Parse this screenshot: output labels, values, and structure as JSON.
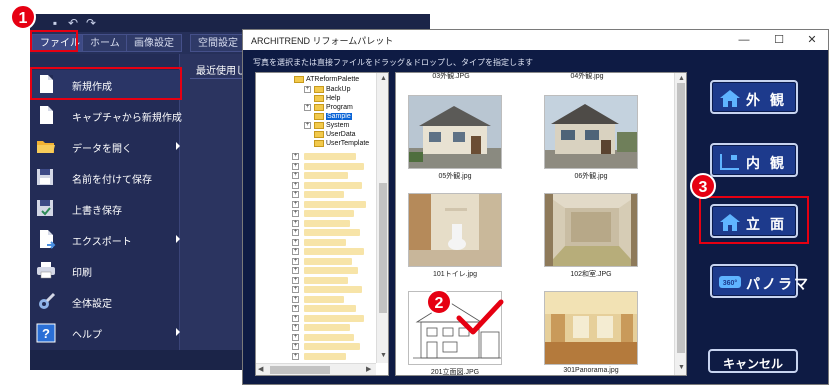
{
  "app": {
    "ribbon_tabs": [
      "ファイル",
      "ホーム",
      "画像設定",
      "空間設定"
    ],
    "file_menu": {
      "items": [
        {
          "label": "新規作成",
          "icon": "new-document-icon",
          "has_submenu": false
        },
        {
          "label": "キャプチャから新規作成",
          "icon": "capture-document-icon",
          "has_submenu": false
        },
        {
          "label": "データを開く",
          "icon": "open-folder-icon",
          "has_submenu": true
        },
        {
          "label": "名前を付けて保存",
          "icon": "save-as-icon",
          "has_submenu": false
        },
        {
          "label": "上書き保存",
          "icon": "save-icon",
          "has_submenu": false
        },
        {
          "label": "エクスポート",
          "icon": "export-icon",
          "has_submenu": true
        },
        {
          "label": "印刷",
          "icon": "print-icon",
          "has_submenu": false
        },
        {
          "label": "全体設定",
          "icon": "settings-icon",
          "has_submenu": false
        },
        {
          "label": "ヘルプ",
          "icon": "help-icon",
          "has_submenu": true
        }
      ],
      "recent_label": "最近使用し"
    }
  },
  "dialog": {
    "title": "ARCHITREND リフォームパレット",
    "window_controls": {
      "minimize": "—",
      "maximize": "☐",
      "close": "✕"
    },
    "instruction": "写真を選択または直接ファイルをドラッグ＆ドロップし、タイプを指定します",
    "tree": {
      "root": "ATReformPalette",
      "children": [
        "BackUp",
        "Help",
        "Program",
        "Sample",
        "System",
        "UserData",
        "UserTemplate"
      ],
      "selected": "Sample"
    },
    "images": {
      "top_captions": [
        "03外観.JPG",
        "04外観.jpg"
      ],
      "items": [
        {
          "caption": "05外観.jpg"
        },
        {
          "caption": "06外観.jpg"
        },
        {
          "caption": "101トイレ.jpg"
        },
        {
          "caption": "102和室.JPG"
        },
        {
          "caption": "201立面図.JPG"
        },
        {
          "caption": "301Panorama.jpg"
        }
      ]
    },
    "view_buttons": [
      {
        "label": "外観",
        "icon": "exterior-house-icon"
      },
      {
        "label": "内観",
        "icon": "interior-room-icon"
      },
      {
        "label": "立面",
        "icon": "elevation-house-icon"
      },
      {
        "label": "パノラマ",
        "icon": "panorama-360-icon"
      }
    ],
    "cancel_label": "キャンセル"
  },
  "annotations": {
    "step1": "1",
    "step2": "2",
    "step3": "3"
  },
  "colors": {
    "annotation_red": "#e60012",
    "dialog_background": "#0e1b44",
    "button_blue": "#1d3a8c",
    "selection_blue": "#0a64d6"
  }
}
